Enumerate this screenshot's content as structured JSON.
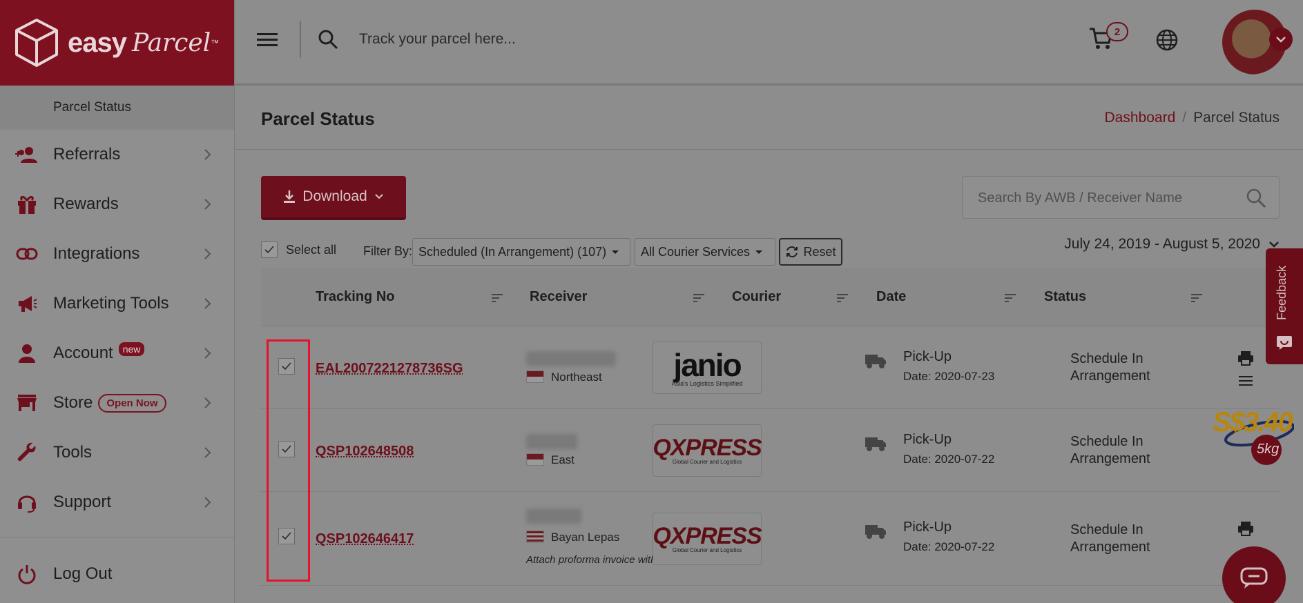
{
  "brand": {
    "name": "easy",
    "script": "Parcel",
    "tm": "™"
  },
  "sidebar": {
    "sub_item": "Parcel Status",
    "items": [
      {
        "label": "Referrals",
        "icon": "referrals-icon"
      },
      {
        "label": "Rewards",
        "icon": "gift-icon"
      },
      {
        "label": "Integrations",
        "icon": "link-icon"
      },
      {
        "label": "Marketing Tools",
        "icon": "megaphone-icon"
      },
      {
        "label": "Account",
        "icon": "user-icon",
        "badge": "new"
      },
      {
        "label": "Store",
        "icon": "store-icon",
        "badge": "Open Now"
      },
      {
        "label": "Tools",
        "icon": "wrench-icon"
      },
      {
        "label": "Support",
        "icon": "headset-icon"
      }
    ],
    "logout": "Log Out"
  },
  "topbar": {
    "search_placeholder": "Track your parcel here...",
    "cart_count": "2"
  },
  "page": {
    "title": "Parcel Status",
    "breadcrumb": {
      "home": "Dashboard",
      "sep": "/",
      "current": "Parcel Status"
    }
  },
  "toolbar": {
    "download": "Download",
    "awb_placeholder": "Search By AWB / Receiver Name",
    "select_all": "Select all",
    "filter_by": "Filter By:",
    "filter_status": "Scheduled (In Arrangement) (107)",
    "filter_courier": "All Courier Services",
    "reset": "Reset",
    "date_range": "July 24, 2019 - August 5, 2020"
  },
  "table": {
    "headers": [
      "Tracking No",
      "Receiver",
      "Courier",
      "Date",
      "Status"
    ],
    "rows": [
      {
        "tracking": "EAL2007221278736SG",
        "area": "Northeast",
        "flag": "sg",
        "courier": "janio",
        "courier_tag": "Asia's Logistics Simplified",
        "pickup": "Pick-Up",
        "date": "Date: 2020-07-23",
        "status": "Schedule In Arrangement"
      },
      {
        "tracking": "QSP102648508",
        "area": "East",
        "flag": "sg",
        "courier": "QXPRESS",
        "courier_tag": "Global Courier and Logistics",
        "pickup": "Pick-Up",
        "date": "Date: 2020-07-22",
        "status": "Schedule In Arrangement"
      },
      {
        "tracking": "QSP102646417",
        "area": "Bayan Lepas",
        "flag": "my",
        "courier": "QXPRESS",
        "courier_tag": "Global Courier and Logistics",
        "pickup": "Pick-Up",
        "date": "Date: 2020-07-22",
        "status": "Schedule In Arrangement",
        "note": "Attach proforma invoice with AWB."
      }
    ]
  },
  "feedback": "Feedback",
  "promo": {
    "price": "S$3.40",
    "weight": "5kg"
  },
  "colors": {
    "brand": "#c8102e",
    "highlight": "#e8102a"
  }
}
